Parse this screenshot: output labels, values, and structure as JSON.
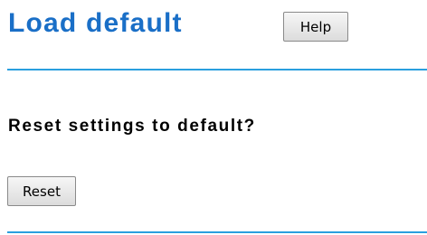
{
  "header": {
    "title": "Load default",
    "help_label": "Help"
  },
  "main": {
    "question": "Reset settings to default?",
    "reset_label": "Reset"
  },
  "colors": {
    "title": "#1a6fc7",
    "divider": "#2a9fde"
  }
}
